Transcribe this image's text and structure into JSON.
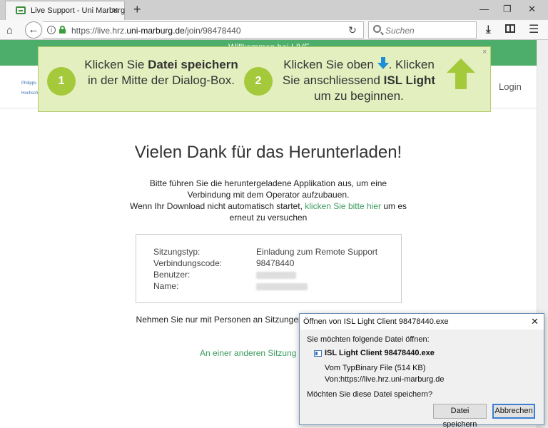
{
  "browser": {
    "tab_title": "Live Support - Uni Marburg",
    "tab_close": "×",
    "new_tab": "+",
    "url_prefix": "https://live.hrz.",
    "url_domain": "uni-marburg.de",
    "url_path": "/join/98478440",
    "search_placeholder": "Suchen"
  },
  "page": {
    "banner_text": "Willkommen bei LIVE",
    "login_label": "Login",
    "heading": "Vielen Dank für das Herunterladen!",
    "para_line1": "Bitte führen Sie die heruntergeladene Applikation aus, um eine Verbindung mit dem Operator aufzubauen.",
    "para_line2_pre": "Wenn Ihr Download nicht automatisch startet,",
    "para_link": "klicken Sie bitte hier",
    "para_line2_post": "um es erneut zu versuchen",
    "info": {
      "session_type_label": "Sitzungstyp:",
      "session_type_value": "Einladung zum Remote Support",
      "code_label": "Verbindungscode:",
      "code_value": "98478440",
      "user_label": "Benutzer:",
      "name_label": "Name:"
    },
    "bottom_text": "Nehmen Sie nur mit Personen an Sitzungen teil, denen Sie vertrauen.",
    "other_session_link": "An einer anderen Sitzung teilnehmen"
  },
  "overlay": {
    "close": "×",
    "step1_number": "1",
    "step1_pre": "Klicken Sie ",
    "step1_bold": "Datei speichern",
    "step1_post": " in der Mitte der Dialog-Box.",
    "step2_number": "2",
    "step2_pre": "Klicken Sie oben ",
    "step2_mid": ". Klicken Sie anschliessend ",
    "step2_bold": "ISL Light",
    "step2_post": " um zu beginnen."
  },
  "dialog": {
    "title": "Öffnen von ISL Light Client 98478440.exe",
    "close": "✕",
    "question": "Sie möchten folgende Datei öffnen:",
    "filename": "ISL Light Client 98478440.exe",
    "type_label": "Vom Typ:",
    "type_value": "Binary File (514 KB)",
    "from_label": "Von:",
    "from_value": "https://live.hrz.uni-marburg.de",
    "save_question": "Möchten Sie diese Datei speichern?",
    "save_button": "Datei speichern",
    "cancel_button": "Abbrechen"
  }
}
